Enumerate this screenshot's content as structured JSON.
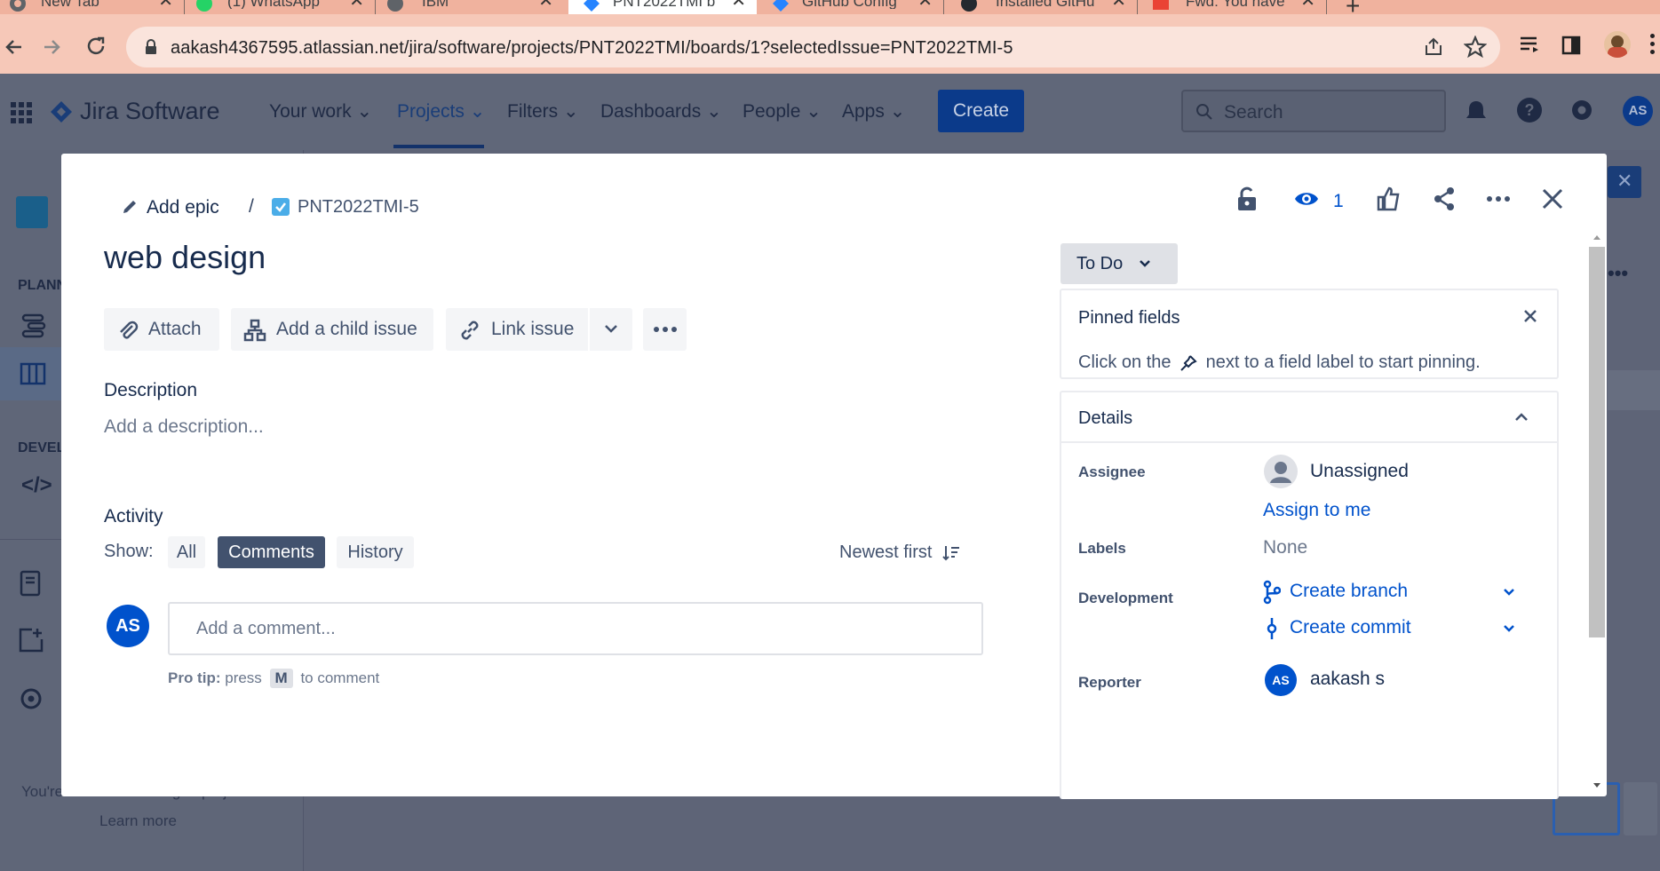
{
  "browser": {
    "tabs": [
      {
        "title": "New Tab",
        "icon": "chrome-icon"
      },
      {
        "title": "(1) WhatsApp",
        "icon": "whatsapp-icon"
      },
      {
        "title": "IBM",
        "icon": "globe-icon"
      },
      {
        "title": "PNT2022TMI b",
        "icon": "jira-icon"
      },
      {
        "title": "GitHub Config",
        "icon": "jira-icon"
      },
      {
        "title": "Installed GitHu",
        "icon": "github-icon"
      },
      {
        "title": "Fwd: You have",
        "icon": "gmail-icon"
      }
    ],
    "url": "aakash4367595.atlassian.net/jira/software/projects/PNT2022TMI/boards/1?selectedIssue=PNT2022TMI-5"
  },
  "topnav": {
    "product": "Jira Software",
    "items": [
      {
        "label": "Your work"
      },
      {
        "label": "Projects"
      },
      {
        "label": "Filters"
      },
      {
        "label": "Dashboards"
      },
      {
        "label": "People"
      },
      {
        "label": "Apps"
      }
    ],
    "create_label": "Create",
    "search_placeholder": "Search",
    "avatar_initials": "AS"
  },
  "sidebar": {
    "planning_label": "PLANN",
    "dev_label": "DEVEL",
    "footer_text": "You're in a team-managed project",
    "learn_more": "Learn more"
  },
  "modal": {
    "breadcrumb": {
      "add_epic": "Add epic",
      "separator": "/",
      "issue_key": "PNT2022TMI-5"
    },
    "watchers_count": "1",
    "title": "web design",
    "toolbar": {
      "attach": "Attach",
      "add_child": "Add a child issue",
      "link_issue": "Link issue"
    },
    "description": {
      "heading": "Description",
      "placeholder": "Add a description..."
    },
    "activity": {
      "heading": "Activity",
      "show_label": "Show:",
      "filters": [
        "All",
        "Comments",
        "History"
      ],
      "selected_filter": "Comments",
      "sort_label": "Newest first",
      "comment_placeholder": "Add a comment...",
      "avatar_initials": "AS",
      "protip_bold": "Pro tip:",
      "protip_press": "press",
      "protip_key": "M",
      "protip_suffix": "to comment"
    },
    "status": "To Do",
    "pinned": {
      "heading": "Pinned fields",
      "text_before": "Click on the",
      "text_after": "next to a field label to start pinning."
    },
    "details": {
      "heading": "Details",
      "assignee_label": "Assignee",
      "assignee_value": "Unassigned",
      "assign_to_me": "Assign to me",
      "labels_label": "Labels",
      "labels_value": "None",
      "development_label": "Development",
      "create_branch": "Create branch",
      "create_commit": "Create commit",
      "reporter_label": "Reporter",
      "reporter_initials": "AS",
      "reporter_name": "aakash s"
    }
  },
  "colors": {
    "brand_blue": "#0052cc",
    "create_button": "#0b3a8a",
    "overlay": "#5e6477"
  }
}
